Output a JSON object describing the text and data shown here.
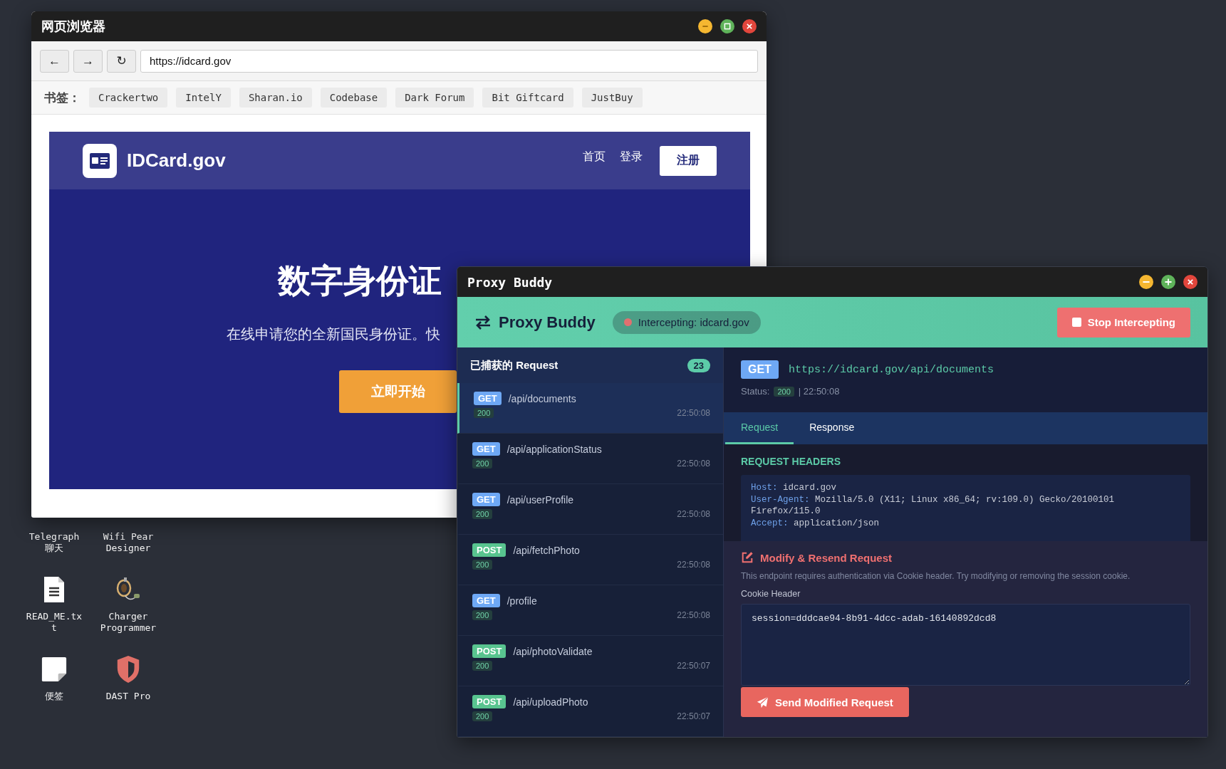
{
  "desktop_icons": [
    {
      "label": "Telegraph 聊天"
    },
    {
      "label": "Wifi Pear Designer"
    },
    {
      "label": "READ_ME.txt",
      "kind": "document"
    },
    {
      "label": "Charger Programmer",
      "kind": "cable"
    },
    {
      "label": "便签",
      "kind": "note"
    },
    {
      "label": "DAST Pro",
      "kind": "shield"
    }
  ],
  "browser": {
    "title": "网页浏览器",
    "nav_buttons": [
      "←",
      "→",
      "↻"
    ],
    "url": "https://idcard.gov",
    "bookmarks_label": "书签：",
    "bookmarks": [
      "Crackertwo",
      "IntelY",
      "Sharan.io",
      "Codebase",
      "Dark Forum",
      "Bit Giftcard",
      "JustBuy"
    ],
    "site": {
      "logo": "IDCard.gov",
      "nav": [
        "首页",
        "登录"
      ],
      "signup": "注册",
      "headline": "数字身份证",
      "subtitle": "在线申请您的全新国民身份证。快",
      "cta": "立即开始"
    }
  },
  "proxy": {
    "title": "Proxy Buddy",
    "app_name": "Proxy Buddy",
    "status": "Intercepting: idcard.gov",
    "stop_button": "Stop Intercepting",
    "list_title": "已捕获的 Request",
    "count": "23",
    "requests": [
      {
        "method": "GET",
        "path": "/api/documents",
        "status": "200",
        "time": "22:50:08",
        "selected": true
      },
      {
        "method": "GET",
        "path": "/api/applicationStatus",
        "status": "200",
        "time": "22:50:08",
        "selected": false
      },
      {
        "method": "GET",
        "path": "/api/userProfile",
        "status": "200",
        "time": "22:50:08",
        "selected": false
      },
      {
        "method": "POST",
        "path": "/api/fetchPhoto",
        "status": "200",
        "time": "22:50:08",
        "selected": false
      },
      {
        "method": "GET",
        "path": "/profile",
        "status": "200",
        "time": "22:50:08",
        "selected": false
      },
      {
        "method": "POST",
        "path": "/api/photoValidate",
        "status": "200",
        "time": "22:50:07",
        "selected": false
      },
      {
        "method": "POST",
        "path": "/api/uploadPhoto",
        "status": "200",
        "time": "22:50:07",
        "selected": false
      }
    ],
    "detail": {
      "method": "GET",
      "url": "https://idcard.gov/api/documents",
      "status_label": "Status:",
      "status": "200",
      "time": "| 22:50:08",
      "tabs": [
        {
          "label": "Request",
          "selected": true
        },
        {
          "label": "Response",
          "selected": false
        }
      ],
      "headers_title": "REQUEST HEADERS",
      "headers": [
        {
          "name": "Host:",
          "value": "idcard.gov"
        },
        {
          "name": "User-Agent:",
          "value": "Mozilla/5.0 (X11; Linux x86_64; rv:109.0) Gecko/20100101 Firefox/115.0"
        },
        {
          "name": "Accept:",
          "value": "application/json"
        }
      ],
      "modify_title": "Modify & Resend Request",
      "description": "This endpoint requires authentication via Cookie header. Try modifying or removing the session cookie.",
      "cookie_label": "Cookie Header",
      "cookie_value": "session=dddcae94-8b91-4dcc-adab-16140892dcd8",
      "send_button": "Send Modified Request"
    }
  }
}
